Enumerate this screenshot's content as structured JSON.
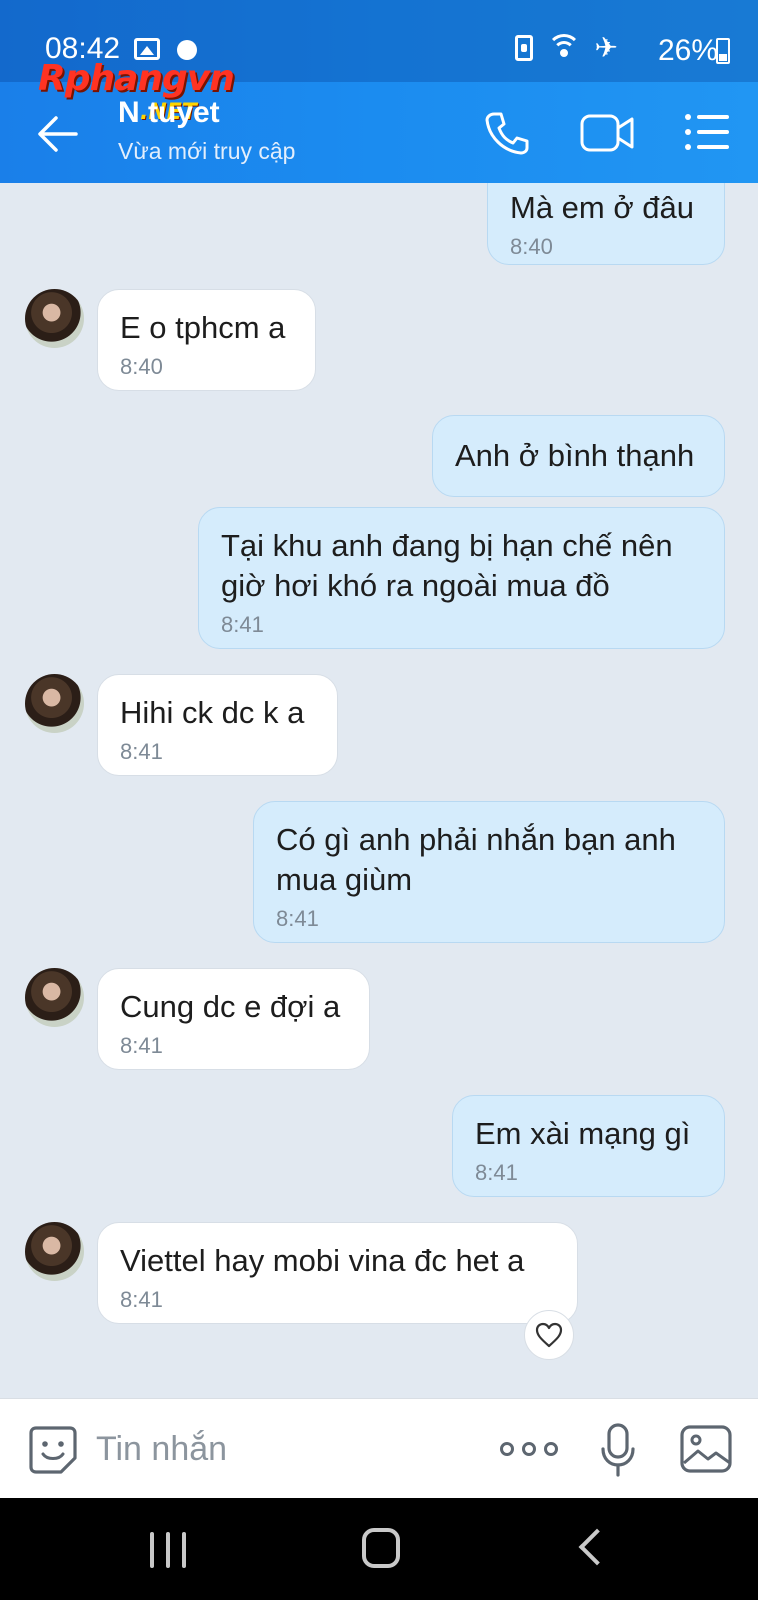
{
  "status_bar": {
    "time": "08:42",
    "battery_text": "26%",
    "icons": [
      "gallery-icon",
      "chat-bubble-icon",
      "battery-saver-icon",
      "wifi-icon",
      "airplane-icon",
      "battery-icon"
    ]
  },
  "watermark": {
    "text": "Rphangvn",
    "suffix": ".NET"
  },
  "header": {
    "contact_name": "N  tuyet",
    "contact_status": "Vừa mới truy cập",
    "accent_color": "#1b8cf0"
  },
  "messages": [
    {
      "direction": "out",
      "text": "Mà em ở đâu",
      "time": "8:40"
    },
    {
      "direction": "in",
      "text": "E o tphcm a",
      "time": "8:40"
    },
    {
      "direction": "out",
      "text": "Anh ở bình thạnh",
      "time": ""
    },
    {
      "direction": "out",
      "text": "Tại khu anh đang bị hạn chế nên giờ hơi khó ra ngoài mua đồ",
      "time": "8:41"
    },
    {
      "direction": "in",
      "text": "Hihi ck dc k a",
      "time": "8:41"
    },
    {
      "direction": "out",
      "text": "Có gì anh phải nhắn bạn anh mua giùm",
      "time": "8:41"
    },
    {
      "direction": "in",
      "text": "Cung dc e đợi a",
      "time": "8:41"
    },
    {
      "direction": "out",
      "text": "Em xài mạng gì",
      "time": "8:41"
    },
    {
      "direction": "in",
      "text": "Viettel hay mobi vina đc het a",
      "time": "8:41"
    }
  ],
  "composer": {
    "placeholder": "Tin nhắn",
    "value": ""
  },
  "colors": {
    "outgoing_bubble": "#d5ecfc",
    "incoming_bubble": "#ffffff",
    "chat_background": "#e2e9f1"
  }
}
